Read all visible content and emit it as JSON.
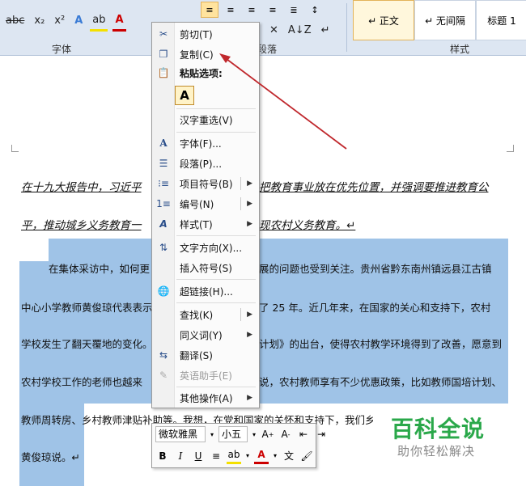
{
  "ribbon": {
    "font_group_label": "字体",
    "paragraph_group_label": "段落",
    "styles_group_label": "样式",
    "font_buttons": [
      "abc",
      "x₂",
      "x²"
    ],
    "styles": [
      "↵ 正文",
      "↵ 无间隔",
      "标题 1"
    ]
  },
  "context_menu": {
    "cut": "剪切(T)",
    "copy": "复制(C)",
    "paste_options": "粘贴选项:",
    "paste_keep_text": "A",
    "reconvert": "汉字重选(V)",
    "font": "字体(F)...",
    "paragraph": "段落(P)...",
    "bullets": "项目符号(B)",
    "numbering": "编号(N)",
    "styles": "样式(T)",
    "text_direction": "文字方向(X)...",
    "insert_symbol": "插入符号(S)",
    "hyperlink": "超链接(H)...",
    "lookup": "查找(K)",
    "synonyms": "同义词(Y)",
    "translate": "翻译(S)",
    "english_assistant": "英语助手(E)",
    "more_actions": "其他操作(A)"
  },
  "mini_toolbar": {
    "font_name": "微软雅黑",
    "font_size": "小五",
    "bold": "B",
    "italic": "I",
    "underline": "U"
  },
  "document": {
    "line1_left": "在十九大报告中，习近平",
    "line1_right": "把教育事业放在优先位置，并强调要推进教育公",
    "line2_left": "平，推动城乡义务教育一",
    "line2_right": "现农村义务教育。↵",
    "line3_left": "在集体采访中，如何更",
    "line3_right": "展的问题也受到关注。贵州省黔东南州镇远县江古镇",
    "line4_left": "中心小学教师黄俊琼代表表示",
    "line4_right": "了 25 年。近几年来，在国家的关心和支持下，农村",
    "line5_left": "学校发生了翻天覆地的变化。",
    "line5_right": "计划》的出台，使得农村教学环境得到了改善，愿意到",
    "line6_left": "农村学校工作的老师也越来",
    "line6_right": "说，农村教师享有不少优惠政策，比如教师国培计划、",
    "line7_left": "教师周转房、乡村教师津贴补助等。我想，在党和国家的关怀和支持下，我们乡",
    "line8_left": "黄俊琼说。↵"
  },
  "watermark": {
    "title": "百科全说",
    "subtitle": "助你轻松解决"
  },
  "colors": {
    "selection": "#9fc3e7",
    "arrow": "#c0282d",
    "watermark_green": "#2aa84a"
  }
}
